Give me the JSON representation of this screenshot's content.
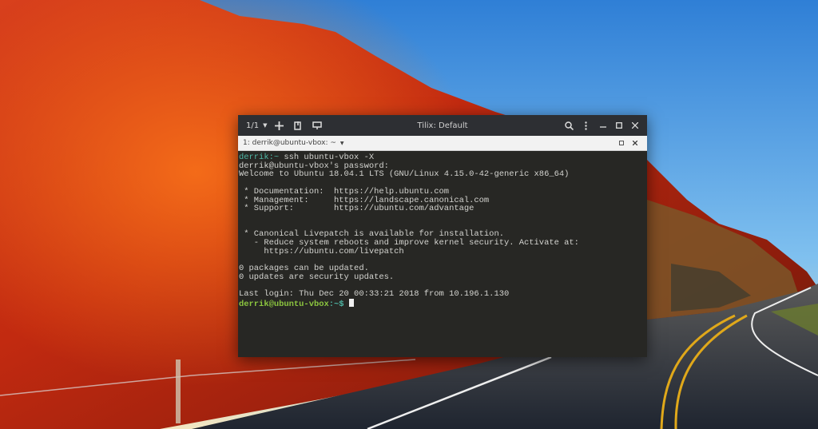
{
  "window": {
    "title": "Tilix: Default",
    "session_counter": "1/1",
    "tab_label": "1: derrik@ubuntu-vbox: ~",
    "icons": [
      "chevron-down-icon",
      "add-icon",
      "split-icon",
      "split-horizontal-icon",
      "search-icon",
      "menu-icon",
      "minimize-icon",
      "maximize-icon",
      "close-icon"
    ]
  },
  "terminal": {
    "lines": [
      {
        "prompt": "derrik:~",
        "text": " ssh ubuntu-vbox -X"
      },
      {
        "text": "derrik@ubuntu-vbox's password:"
      },
      {
        "text": "Welcome to Ubuntu 18.04.1 LTS (GNU/Linux 4.15.0-42-generic x86_64)"
      },
      {
        "text": ""
      },
      {
        "text": " * Documentation:  https://help.ubuntu.com"
      },
      {
        "text": " * Management:     https://landscape.canonical.com"
      },
      {
        "text": " * Support:        https://ubuntu.com/advantage"
      },
      {
        "text": ""
      },
      {
        "text": ""
      },
      {
        "text": " * Canonical Livepatch is available for installation."
      },
      {
        "text": "   - Reduce system reboots and improve kernel security. Activate at:"
      },
      {
        "text": "     https://ubuntu.com/livepatch"
      },
      {
        "text": ""
      },
      {
        "text": "0 packages can be updated."
      },
      {
        "text": "0 updates are security updates."
      },
      {
        "text": ""
      },
      {
        "text": "Last login: Thu Dec 20 00:33:21 2018 from 10.196.1.130"
      }
    ],
    "current_prompt": "derrik@ubuntu-vbox",
    "current_prompt_suffix": ":~$ "
  },
  "colors": {
    "prompt_teal": "#4fb7a5",
    "prompt_green": "#8cc63f",
    "terminal_bg": "#272724",
    "titlebar_bg": "#2d2f33"
  }
}
